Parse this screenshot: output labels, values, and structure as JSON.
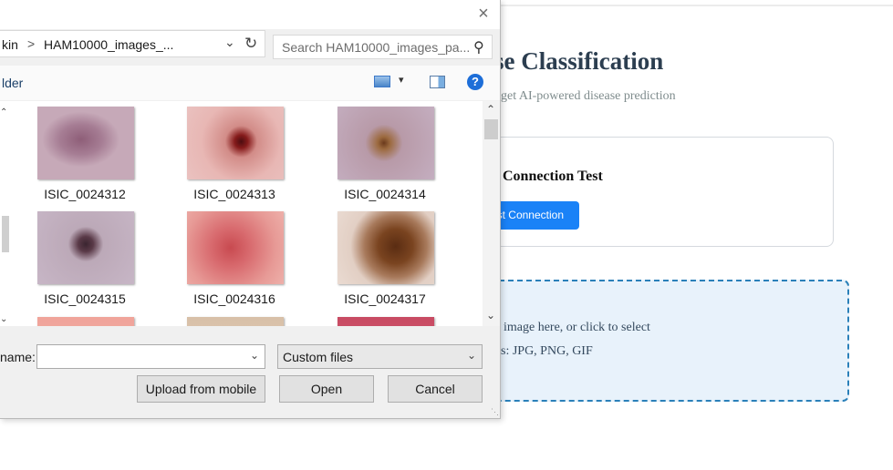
{
  "page": {
    "title": "se Classification",
    "subtitle": "get AI-powered disease prediction",
    "connection": {
      "title": "Connection Test",
      "button_label": "st Connection"
    },
    "dropzone": {
      "line1": "image here, or click to select",
      "line2": "s: JPG, PNG, GIF"
    }
  },
  "dialog": {
    "close_icon": "×",
    "address": {
      "segment1": "kin",
      "separator": ">",
      "segment2": "HAM10000_images_...",
      "dropdown_icon": "chevron-down-icon",
      "refresh_icon": "refresh-icon"
    },
    "search": {
      "placeholder": "Search HAM10000_images_pa..."
    },
    "toolbar": {
      "new_folder": "lder",
      "view_icon": "view-icon",
      "pane_icon": "preview-pane-icon",
      "help": "?"
    },
    "files": [
      {
        "name": "ISIC_0024312"
      },
      {
        "name": "ISIC_0024313"
      },
      {
        "name": "ISIC_0024314"
      },
      {
        "name": "ISIC_0024315"
      },
      {
        "name": "ISIC_0024316"
      },
      {
        "name": "ISIC_0024317"
      },
      {
        "name": ""
      },
      {
        "name": ""
      },
      {
        "name": ""
      }
    ],
    "filename_label": "name:",
    "filename_value": "",
    "filetype": "Custom files",
    "buttons": {
      "upload_mobile": "Upload from mobile",
      "open": "Open",
      "cancel": "Cancel"
    }
  },
  "colors": {
    "accent_button": "#1a82f7",
    "dropzone_border": "#2a80b9",
    "dropzone_bg": "#e8f2fb",
    "title_text": "#2c3e50",
    "help_icon": "#1d6ed8"
  }
}
